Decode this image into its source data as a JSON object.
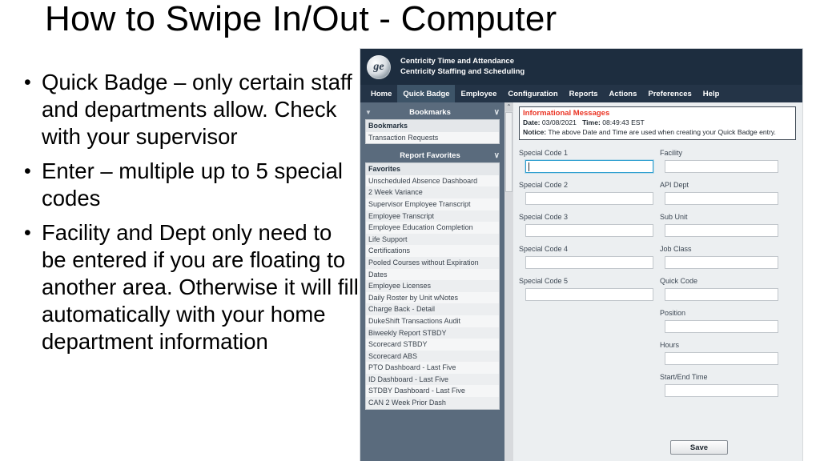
{
  "slide": {
    "title": "How to Swipe In/Out - Computer",
    "bullets": [
      "Quick Badge – only certain staff and departments allow.  Check with your supervisor",
      "Enter – multiple up to 5 special codes",
      "Facility and Dept only need to be entered if you are floating to another area.  Otherwise it will fill automatically with your home department information"
    ],
    "bullet_marker": "•"
  },
  "app": {
    "brand": {
      "logo": "ge-logo",
      "line1": "Centricity Time and Attendance",
      "line2": "Centricity Staffing and Scheduling"
    },
    "nav": {
      "items": [
        {
          "label": "Home",
          "active": false
        },
        {
          "label": "Quick Badge",
          "active": true
        },
        {
          "label": "Employee",
          "active": false
        },
        {
          "label": "Configuration",
          "active": false
        },
        {
          "label": "Reports",
          "active": false
        },
        {
          "label": "Actions",
          "active": false
        },
        {
          "label": "Preferences",
          "active": false
        },
        {
          "label": "Help",
          "active": false
        }
      ]
    },
    "sidebar": {
      "bookmarks_panel": {
        "title": "Bookmarks",
        "collapse_icon": "triangle-down-icon",
        "chevron_icon": "chevron-down-icon",
        "rows": [
          "Bookmarks",
          "Transaction Requests"
        ]
      },
      "report_favorites_panel": {
        "title": "Report Favorites",
        "chevron_icon": "chevron-down-icon",
        "rows": [
          "Favorites",
          "Unscheduled Absence Dashboard",
          "2 Week Variance",
          "Supervisor Employee Transcript",
          "Employee Transcript",
          "Employee Education Completion",
          "Life Support",
          "Certifications",
          "Pooled Courses without Expiration",
          "Dates",
          "Employee Licenses",
          "Daily Roster by Unit wNotes",
          "Charge Back - Detail",
          "DukeShift Transactions Audit",
          "Biweekly Report STBDY",
          "Scorecard STBDY",
          "Scorecard ABS",
          "PTO Dashboard - Last Five",
          "ID Dashboard - Last Five",
          "STDBY Dashboard - Last Five",
          "CAN 2 Week Prior Dash"
        ]
      },
      "scrollbar": {
        "up_arrow": "⌃"
      }
    },
    "info_box": {
      "title": "Informational Messages",
      "date_label": "Date:",
      "date_value": "03/08/2021",
      "time_label": "Time:",
      "time_value": "08:49:43 EST",
      "notice_label": "Notice:",
      "notice_value": "The above Date and Time are used when creating your Quick Badge entry."
    },
    "form": {
      "left_fields": [
        {
          "label": "Special Code 1",
          "value": "",
          "focused": true
        },
        {
          "label": "Special Code 2",
          "value": "",
          "focused": false
        },
        {
          "label": "Special Code 3",
          "value": "",
          "focused": false
        },
        {
          "label": "Special Code 4",
          "value": "",
          "focused": false
        },
        {
          "label": "Special Code 5",
          "value": "",
          "focused": false
        }
      ],
      "right_fields": [
        {
          "label": "Facility",
          "value": "",
          "focused": false
        },
        {
          "label": "API Dept",
          "value": "",
          "focused": false
        },
        {
          "label": "Sub Unit",
          "value": "",
          "focused": false
        },
        {
          "label": "Job Class",
          "value": "",
          "focused": false
        },
        {
          "label": "Quick Code",
          "value": "",
          "focused": false
        },
        {
          "label": "Position",
          "value": "",
          "focused": false
        },
        {
          "label": "Hours",
          "value": "",
          "focused": false
        },
        {
          "label": "Start/End Time",
          "value": "",
          "focused": false
        }
      ],
      "save_label": "Save"
    },
    "colors": {
      "brand_bar": "#1d2d3f",
      "nav_bar": "#243447",
      "nav_active": "#3d5468",
      "sidebar": "#5a6b7d",
      "form_bg": "#eceff1",
      "alert_red": "#ea3323",
      "focus_blue": "#2f9fd0"
    }
  }
}
